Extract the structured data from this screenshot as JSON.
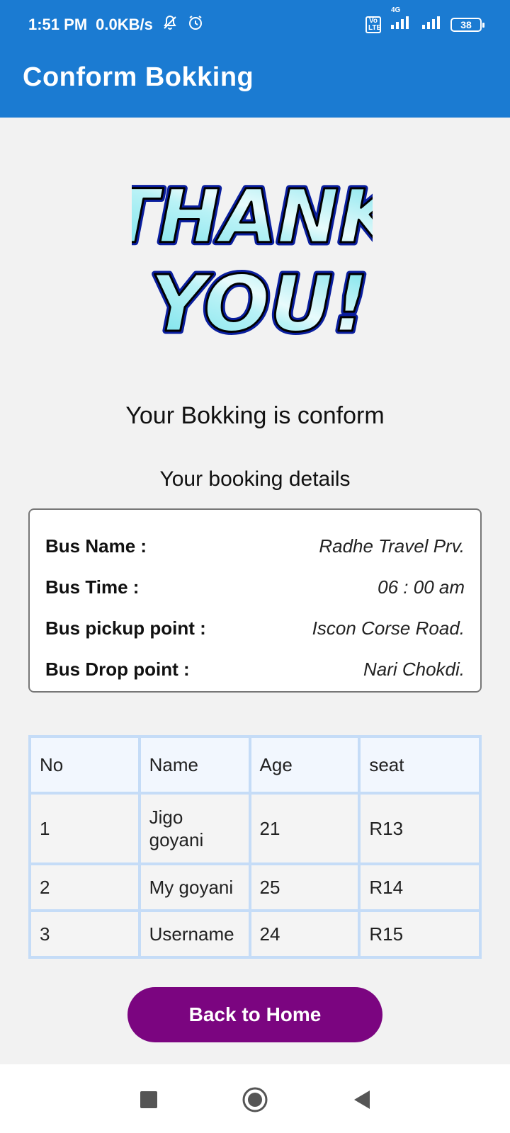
{
  "status_bar": {
    "time": "1:51 PM",
    "net_speed": "0.0KB/s",
    "network_label": "4G",
    "volte_label": "Vo LTE",
    "battery": "38",
    "icons": [
      "mute-icon",
      "alarm-icon",
      "volte-icon",
      "signal-icon",
      "signal-icon",
      "battery-icon"
    ]
  },
  "app_bar": {
    "title": "Conform Bokking",
    "color": "#1b7bd2"
  },
  "thank_you_image": {
    "line1": "THANK",
    "line2": "YOU!"
  },
  "confirmation": {
    "heading": "Your Bokking is conform",
    "subheading": "Your booking details"
  },
  "details": [
    {
      "label": "Bus Name :",
      "value": "Radhe Travel Prv."
    },
    {
      "label": "Bus Time :",
      "value": "06 : 00 am"
    },
    {
      "label": "Bus pickup point :",
      "value": "Iscon Corse Road."
    },
    {
      "label": "Bus Drop point :",
      "value": "Nari Chokdi."
    }
  ],
  "passengers": {
    "columns": [
      "No",
      "Name",
      "Age",
      "seat"
    ],
    "rows": [
      [
        "1",
        "Jigo goyani",
        "21",
        "R13"
      ],
      [
        "2",
        "My goyani",
        "25",
        "R14"
      ],
      [
        "3",
        "Username",
        "24",
        "R15"
      ]
    ]
  },
  "back_button": {
    "label": "Back to Home",
    "color": "#7b0580"
  },
  "nav_bar": {
    "icons": [
      "recents-square-icon",
      "home-circle-icon",
      "back-triangle-icon"
    ]
  }
}
